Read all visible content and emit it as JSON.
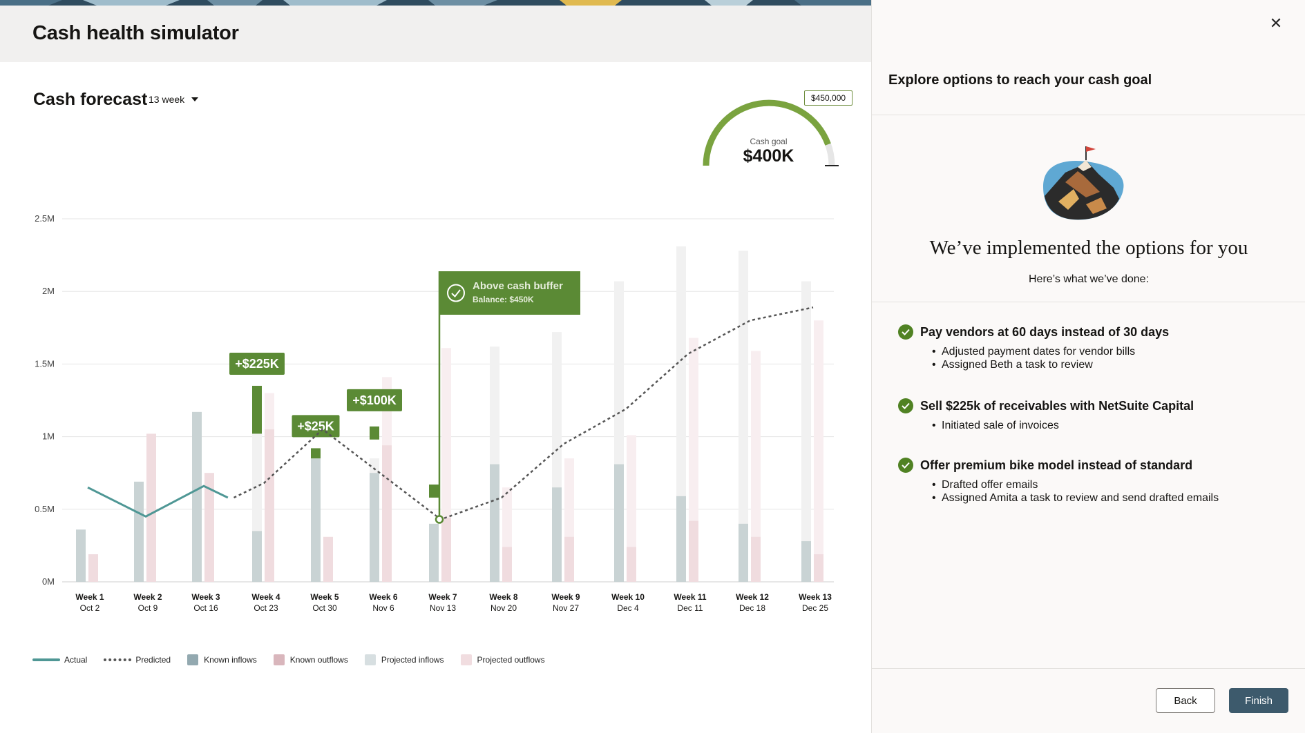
{
  "app": {
    "title": "Cash health simulator"
  },
  "forecast": {
    "title": "Cash forecast",
    "period": "13 week"
  },
  "gauge": {
    "label": "Cash goal",
    "value": "$400K",
    "max_label": "$450,000",
    "fill_fraction": 0.89,
    "color": "#7aa33f"
  },
  "colors": {
    "actual": "#4f9795",
    "predicted": "#555555",
    "known_inflows": "#c9d3d4",
    "known_outflows": "#f0dcdf",
    "projected_inflows": "#f1f1f1",
    "projected_outflows": "#f8eef0",
    "uplift": "#5b8a35",
    "accent": "#3d5a6c"
  },
  "chart_data": {
    "type": "bar",
    "ylim": [
      0,
      2.5
    ],
    "yticks": [
      "0M",
      "0.5M",
      "1M",
      "1.5M",
      "2M",
      "2.5M"
    ],
    "categories": [
      "Week 1",
      "Week 2",
      "Week 3",
      "Week 4",
      "Week 5",
      "Week 6",
      "Week 7",
      "Week 8",
      "Week 9",
      "Week 10",
      "Week 11",
      "Week 12",
      "Week 13"
    ],
    "dates": [
      "Oct 2",
      "Oct 9",
      "Oct 16",
      "Oct 23",
      "Oct 30",
      "Nov 6",
      "Nov 13",
      "Nov 20",
      "Nov 27",
      "Dec 4",
      "Dec 11",
      "Dec 18",
      "Dec 25"
    ],
    "series": [
      {
        "name": "Known inflows",
        "values": [
          0.36,
          0.69,
          1.17,
          0.35,
          0.85,
          0.75,
          0.4,
          0.81,
          0.65,
          0.81,
          0.59,
          0.4,
          0.28
        ]
      },
      {
        "name": "Projected inflows",
        "values": [
          0,
          0,
          0,
          0.67,
          0,
          0.1,
          0,
          0.81,
          1.07,
          1.26,
          1.72,
          1.88,
          1.79
        ]
      },
      {
        "name": "Known outflows",
        "values": [
          0.19,
          1.02,
          0.75,
          1.05,
          0.31,
          0.94,
          0.44,
          0.24,
          0.31,
          0.24,
          0.42,
          0.31,
          0.19
        ]
      },
      {
        "name": "Projected outflows",
        "values": [
          0,
          0,
          0,
          0.25,
          0,
          0.47,
          1.17,
          0.41,
          0.54,
          0.77,
          1.26,
          1.28,
          1.61
        ]
      },
      {
        "name": "Actual",
        "values": [
          0.65,
          0.45,
          0.66,
          0.58
        ]
      },
      {
        "name": "Predicted",
        "values": [
          0.58,
          0.68,
          1.05,
          0.43,
          0.58,
          0.95,
          1.19,
          1.57,
          1.8,
          1.89
        ]
      }
    ],
    "predicted_x": [
      3.5,
      4,
      5,
      7,
      8,
      9,
      10,
      11,
      12,
      13
    ],
    "uplifts": [
      {
        "week": 4,
        "label": "+$225K",
        "low": 1.02,
        "high": 1.35
      },
      {
        "week": 5,
        "label": "+$25K",
        "low": 0.85,
        "high": 0.92
      },
      {
        "week": 6,
        "label": "+$100K",
        "low": 0.98,
        "high": 1.07
      },
      {
        "week": 7,
        "label": "",
        "low": 0.58,
        "high": 0.67
      }
    ],
    "marker": {
      "week": 7,
      "title": "Above cash buffer",
      "subtitle": "Balance: $450K"
    },
    "legend": [
      "Actual",
      "Predicted",
      "Known inflows",
      "Known outflows",
      "Projected inflows",
      "Projected outflows"
    ]
  },
  "panel": {
    "title": "Explore options to reach your cash goal",
    "heading": "We’ve implemented the options for you",
    "subheading": "Here’s what we’ve done:",
    "options": [
      {
        "title": "Pay vendors at 60 days instead of 30 days",
        "bullets": [
          "Adjusted payment dates for vendor bills",
          "Assigned Beth a task to review"
        ]
      },
      {
        "title": "Sell $225k of receivables with NetSuite Capital",
        "bullets": [
          "Initiated sale of invoices"
        ]
      },
      {
        "title": "Offer premium bike model instead of standard",
        "bullets": [
          "Drafted offer emails",
          "Assigned Amita a task to review and send drafted emails"
        ]
      }
    ],
    "back_label": "Back",
    "finish_label": "Finish"
  }
}
